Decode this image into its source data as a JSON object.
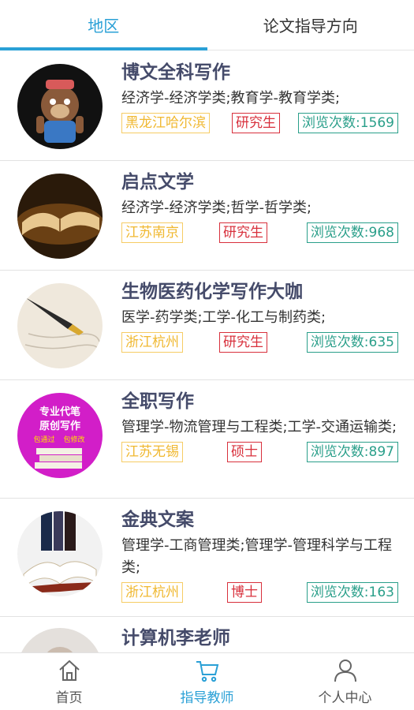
{
  "tabs": [
    {
      "label": "地区",
      "active": true
    },
    {
      "label": "论文指导方向",
      "active": false
    }
  ],
  "teachers": [
    {
      "name": "博文全科写作",
      "subjects": "经济学-经济学类;教育学-教育学类;",
      "region": "黑龙江哈尔滨",
      "degree": "研究生",
      "views": "浏览次数:1569",
      "avatar_icon": "bear-cartoon-avatar"
    },
    {
      "name": "启点文学",
      "subjects": "经济学-经济学类;哲学-哲学类;",
      "region": "江苏南京",
      "degree": "研究生",
      "views": "浏览次数:968",
      "avatar_icon": "open-book-avatar"
    },
    {
      "name": "生物医药化学写作大咖",
      "subjects": "医学-药学类;工学-化工与制药类;",
      "region": "浙江杭州",
      "degree": "研究生",
      "views": "浏览次数:635",
      "avatar_icon": "fountain-pen-avatar"
    },
    {
      "name": "全职写作",
      "subjects": "管理学-物流管理与工程类;工学-交通运输类;",
      "region": "江苏无锡",
      "degree": "硕士",
      "views": "浏览次数:897",
      "avatar_icon": "writing-ad-avatar",
      "avatar_text": [
        "专业代笔",
        "原创写作",
        "包通过",
        "包修改"
      ]
    },
    {
      "name": "金典文案",
      "subjects": "管理学-工商管理类;管理学-管理科学与工程类;",
      "region": "浙江杭州",
      "degree": "博士",
      "views": "浏览次数:163",
      "avatar_icon": "books-avatar"
    },
    {
      "name": "计算机李老师",
      "subjects": "",
      "region": "",
      "degree": "",
      "views": "",
      "avatar_icon": "person-avatar"
    }
  ],
  "bottom_nav": [
    {
      "label": "首页",
      "icon": "home-icon",
      "active": false
    },
    {
      "label": "指导教师",
      "icon": "cart-icon",
      "active": true
    },
    {
      "label": "个人中心",
      "icon": "user-icon",
      "active": false
    }
  ],
  "colors": {
    "accent": "#2aa0d6",
    "title": "#454b6a",
    "region": "#f0b830",
    "degree": "#d8303c",
    "views": "#2a9f8a"
  }
}
